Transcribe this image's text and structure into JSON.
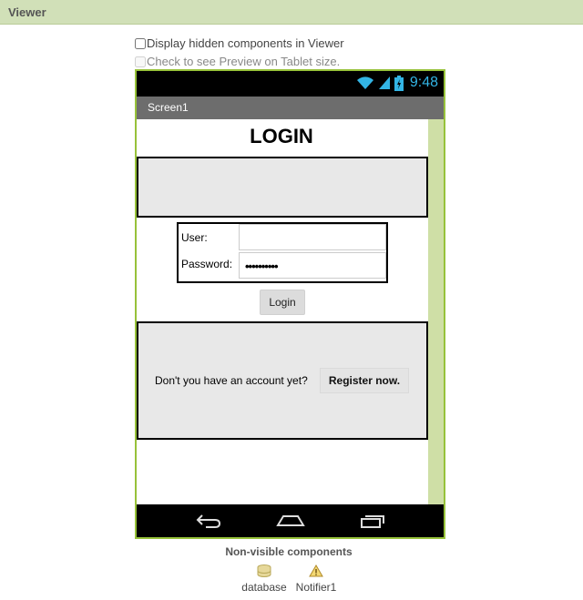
{
  "viewer": {
    "title": "Viewer",
    "options": {
      "display_hidden": "Display hidden components in Viewer",
      "tablet_preview": "Check to see Preview on Tablet size."
    }
  },
  "phone": {
    "status": {
      "time": "9:48",
      "wifi_icon": "wifi-icon",
      "signal_icon": "signal-icon",
      "battery_icon": "battery-icon"
    },
    "screen_title": "Screen1",
    "app": {
      "heading": "LOGIN",
      "user_label": "User:",
      "user_value": "",
      "password_label": "Password:",
      "password_value": "••••••••••",
      "login_button": "Login",
      "register_question": "Don't you have an account yet?",
      "register_button": "Register now."
    },
    "navbar": {
      "back_icon": "back-icon",
      "home_icon": "home-icon",
      "recents_icon": "recents-icon"
    }
  },
  "non_visible": {
    "title": "Non-visible components",
    "items": [
      {
        "label": "database",
        "icon": "database-icon"
      },
      {
        "label": "Notifier1",
        "icon": "warning-icon"
      }
    ]
  },
  "colors": {
    "header_bg": "#d1e0b8",
    "phone_border": "#97c23a",
    "phone_frame": "#cfdfa6",
    "clock": "#33b5e5",
    "panel_bg": "#e8e8e8"
  }
}
